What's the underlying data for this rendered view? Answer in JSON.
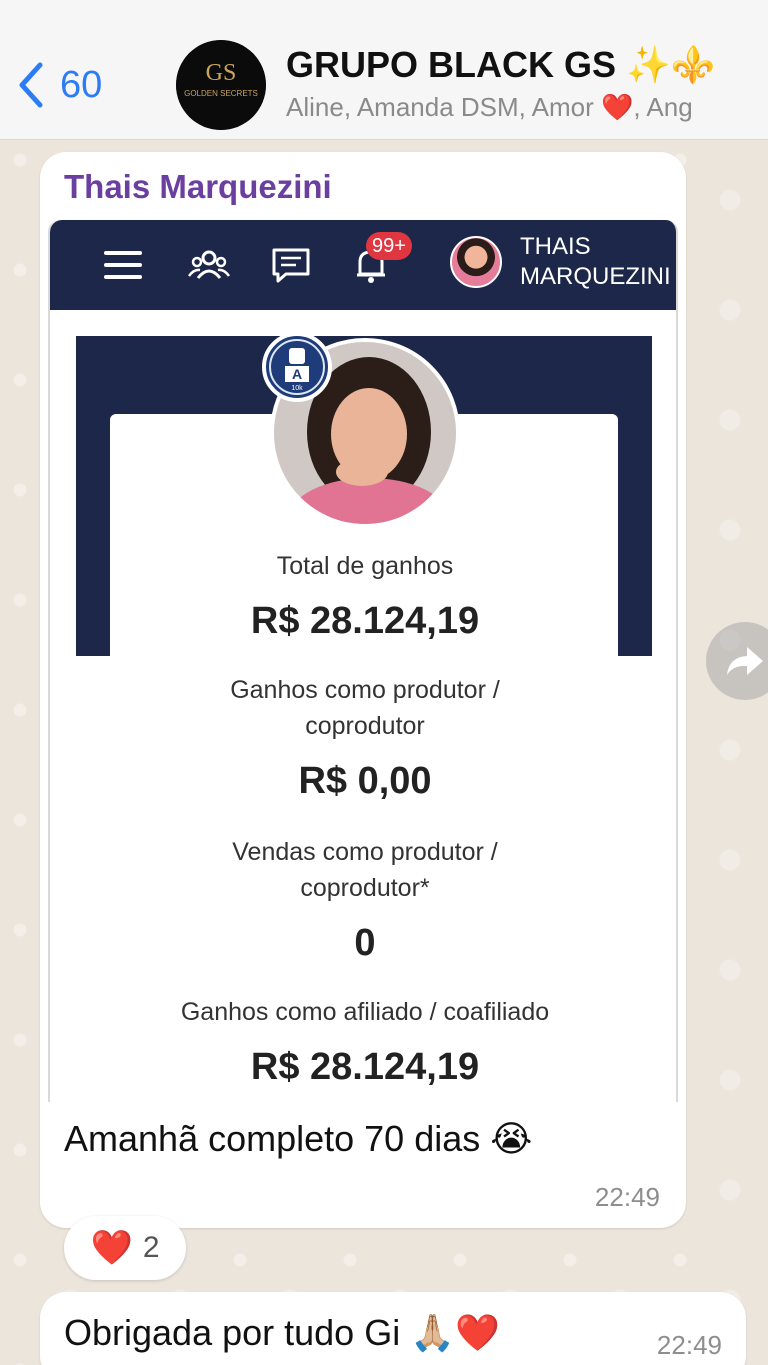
{
  "header": {
    "back_count": "60",
    "group_name": "GRUPO BLACK GS ✨⚜️",
    "members": "Aline, Amanda DSM, Amor ❤️, Ang",
    "avatar_text_top": "GS",
    "avatar_text_mid": "GOLDEN SECRETS"
  },
  "message1": {
    "sender": "Thais Marquezini",
    "text": "Amanhã completo 70 dias 😭",
    "time": "22:49",
    "reaction_emoji": "❤️",
    "reaction_count": "2"
  },
  "screenshot": {
    "notif_badge": "99+",
    "user_line1": "THAIS",
    "user_line2": "MARQUEZINI",
    "level_badge": "A",
    "level_sub": "10k",
    "stats": [
      {
        "label": "Total de ganhos",
        "value": "R$ 28.124,19"
      },
      {
        "label_line1": "Ganhos como produtor /",
        "label_line2": "coprodutor",
        "value": "R$ 0,00"
      },
      {
        "label_line1": "Vendas como produtor /",
        "label_line2": "coprodutor*",
        "value": "0"
      },
      {
        "label": "Ganhos como afiliado / coafiliado",
        "value": "R$ 28.124,19"
      }
    ]
  },
  "message2": {
    "text": "Obrigada por tudo Gi 🙏🏼❤️",
    "time": "22:49"
  }
}
